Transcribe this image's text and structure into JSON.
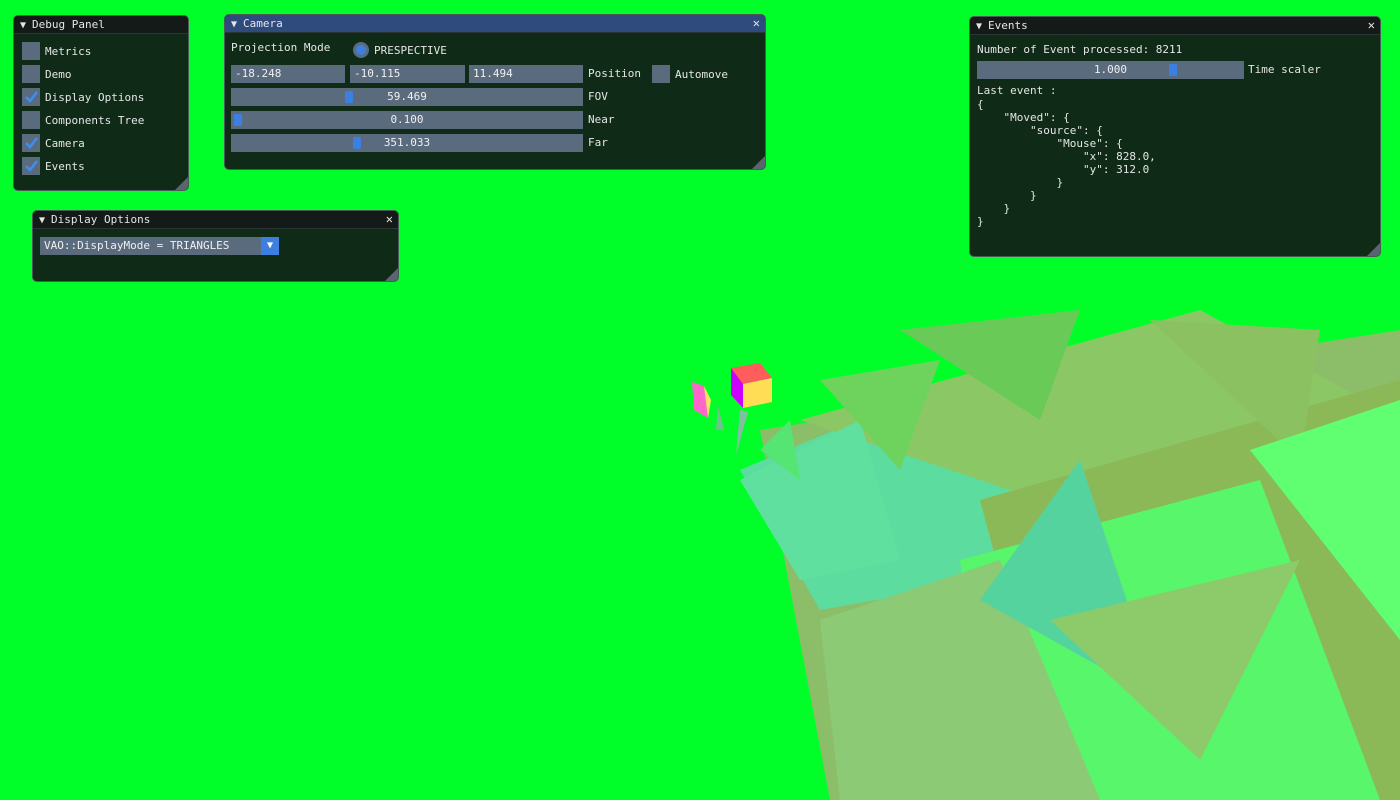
{
  "debug_panel": {
    "title": "Debug Panel",
    "items": [
      {
        "label": "Metrics",
        "checked": false
      },
      {
        "label": "Demo",
        "checked": false
      },
      {
        "label": "Display Options",
        "checked": true
      },
      {
        "label": "Components Tree",
        "checked": false
      },
      {
        "label": "Camera",
        "checked": true
      },
      {
        "label": "Events",
        "checked": true
      }
    ]
  },
  "camera": {
    "title": "Camera",
    "projection_label": "Projection Mode",
    "projection_value": "PRESPECTIVE",
    "position": [
      "-18.248",
      "-10.115",
      "11.494"
    ],
    "position_label": "Position",
    "automove_label": "Automove",
    "automove_checked": false,
    "fov": {
      "value": "59.469",
      "label": "FOV"
    },
    "near": {
      "value": "0.100",
      "label": "Near"
    },
    "far": {
      "value": "351.033",
      "label": "Far"
    }
  },
  "display_options": {
    "title": "Display Options",
    "combo_value": "VAO::DisplayMode = TRIANGLES"
  },
  "events": {
    "title": "Events",
    "processed_text": "Number of Event processed: 8211",
    "time_scaler_value": "1.000",
    "time_scaler_label": "Time scaler",
    "last_event_label": "Last event :",
    "last_event_json": "{\n    \"Moved\": {\n        \"source\": {\n            \"Mouse\": {\n                \"x\": 828.0,\n                \"y\": 312.0\n            }\n        }\n    }\n}"
  },
  "colors": {
    "background": "#00ff28",
    "window_bg": "#101a16",
    "frame": "#5a6b7d",
    "accent": "#3d7fe0",
    "title_active": "#2f4a7d"
  },
  "icons": [
    "collapse-triangle-icon",
    "close-icon",
    "checkmark-icon",
    "resize-grip-icon",
    "combo-arrow-icon"
  ]
}
